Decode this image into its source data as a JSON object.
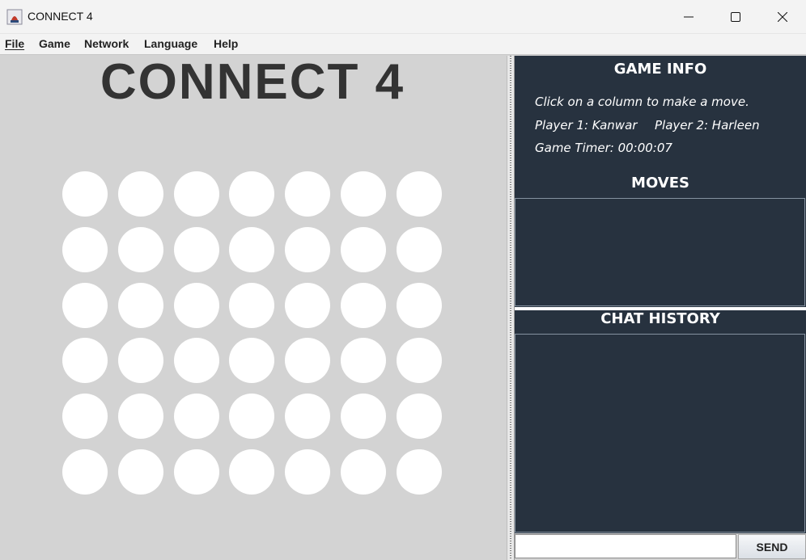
{
  "window": {
    "title": "CONNECT 4",
    "icon": "java-cup-icon",
    "controls": [
      "minimize-icon",
      "maximize-icon",
      "close-icon"
    ]
  },
  "menu": {
    "file": "File",
    "game": "Game",
    "network": "Network",
    "language": "Language",
    "help": "Help"
  },
  "board": {
    "title": "CONNECT 4",
    "rows": 6,
    "columns": 7,
    "cell_color": "#ffffff",
    "background": "#d3d3d3"
  },
  "info": {
    "heading": "GAME INFO",
    "instruction": "Click on a column to make a move.",
    "player1": "Player 1: Kanwar",
    "player2": "Player 2: Harleen",
    "timer": "Game Timer: 00:00:07"
  },
  "moves": {
    "heading": "MOVES"
  },
  "chat": {
    "heading": "CHAT HISTORY",
    "input_value": "",
    "send_label": "SEND"
  },
  "colors": {
    "panel": "#27323f",
    "title_text": "#333333"
  }
}
